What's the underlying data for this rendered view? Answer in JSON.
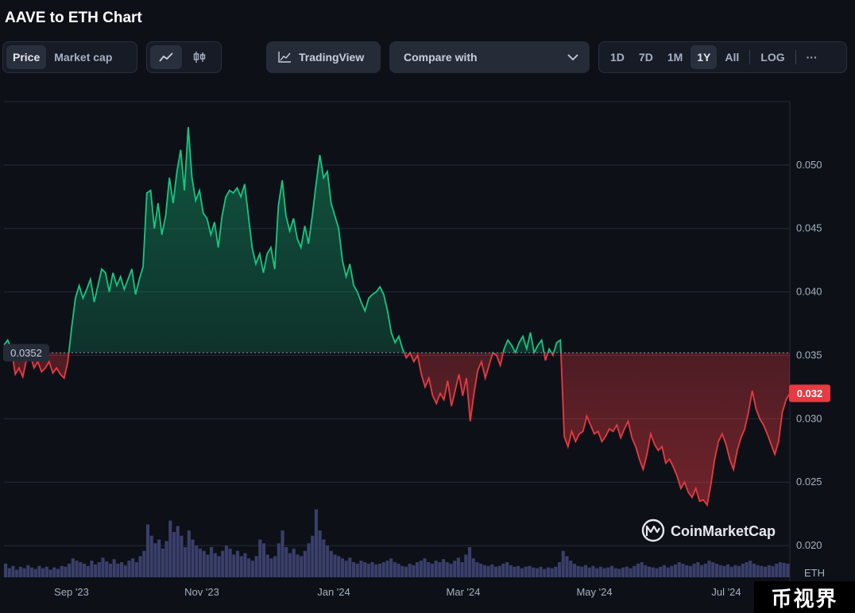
{
  "title": "AAVE to ETH Chart",
  "toolbar": {
    "metric_tabs": [
      "Price",
      "Market cap"
    ],
    "active_metric": "Price",
    "chart_type_icons": [
      "line-chart-icon",
      "candlestick-icon"
    ],
    "tradingview_label": "TradingView",
    "compare_label": "Compare with",
    "ranges": [
      "1D",
      "7D",
      "1M",
      "1Y",
      "All"
    ],
    "active_range": "1Y",
    "log_label": "LOG",
    "more_label": "···"
  },
  "chart_data": {
    "type": "area",
    "baseline_value": 0.0352,
    "baseline_label": "0.0352",
    "current_value": 0.032,
    "current_label": "0.032",
    "y_ticks": [
      "0.050",
      "0.045",
      "0.040",
      "0.035",
      "0.030",
      "0.025",
      "0.020"
    ],
    "ylim": [
      0.0175,
      0.055
    ],
    "x_ticks": [
      "Sep '23",
      "Nov '23",
      "Jan '24",
      "Mar '24",
      "May '24",
      "Jul '24"
    ],
    "unit_label": "ETH",
    "brand_label": "CoinMarketCap",
    "colors": {
      "up": "#16c784",
      "down": "#ea3943",
      "volume": "#3a3f6b",
      "grid": "#252a36"
    },
    "grid": true,
    "price_series": [
      0.0358,
      0.0362,
      0.0355,
      0.0335,
      0.034,
      0.0333,
      0.0347,
      0.035,
      0.034,
      0.0345,
      0.0337,
      0.034,
      0.0345,
      0.0336,
      0.034,
      0.0335,
      0.0332,
      0.0345,
      0.0372,
      0.0395,
      0.0405,
      0.0395,
      0.0402,
      0.041,
      0.0392,
      0.0405,
      0.0418,
      0.0415,
      0.04,
      0.0415,
      0.0405,
      0.0412,
      0.0402,
      0.041,
      0.0418,
      0.0398,
      0.041,
      0.042,
      0.0478,
      0.048,
      0.045,
      0.047,
      0.0445,
      0.046,
      0.049,
      0.047,
      0.0495,
      0.0512,
      0.048,
      0.053,
      0.049,
      0.0472,
      0.048,
      0.0462,
      0.0458,
      0.0445,
      0.0455,
      0.0435,
      0.046,
      0.0475,
      0.048,
      0.0478,
      0.0482,
      0.0475,
      0.0485,
      0.046,
      0.0435,
      0.0422,
      0.043,
      0.0415,
      0.043,
      0.0435,
      0.0418,
      0.0468,
      0.0488,
      0.046,
      0.0448,
      0.0458,
      0.0442,
      0.0435,
      0.0452,
      0.0438,
      0.046,
      0.0485,
      0.0508,
      0.049,
      0.0495,
      0.047,
      0.046,
      0.045,
      0.0425,
      0.0412,
      0.0422,
      0.0405,
      0.04,
      0.0392,
      0.0385,
      0.0395,
      0.0398,
      0.04,
      0.0404,
      0.0398,
      0.0385,
      0.0368,
      0.036,
      0.0365,
      0.0355,
      0.0348,
      0.0352,
      0.0345,
      0.035,
      0.0335,
      0.0325,
      0.0332,
      0.0318,
      0.0312,
      0.032,
      0.0315,
      0.033,
      0.031,
      0.0322,
      0.0335,
      0.0318,
      0.0332,
      0.0298,
      0.032,
      0.0338,
      0.0345,
      0.0332,
      0.0342,
      0.0352,
      0.035,
      0.0342,
      0.0355,
      0.0362,
      0.0358,
      0.0352,
      0.036,
      0.0365,
      0.0355,
      0.0368,
      0.0352,
      0.0358,
      0.0362,
      0.0346,
      0.0355,
      0.035,
      0.036,
      0.0362,
      0.0286,
      0.0278,
      0.029,
      0.0282,
      0.0288,
      0.029,
      0.0302,
      0.0295,
      0.0288,
      0.029,
      0.0282,
      0.0286,
      0.0292,
      0.029,
      0.0295,
      0.0285,
      0.0292,
      0.0298,
      0.0285,
      0.0278,
      0.0268,
      0.026,
      0.0272,
      0.0288,
      0.028,
      0.0275,
      0.0278,
      0.0265,
      0.0268,
      0.0262,
      0.0255,
      0.0245,
      0.025,
      0.0242,
      0.0238,
      0.0245,
      0.0235,
      0.0236,
      0.0232,
      0.0248,
      0.0268,
      0.0282,
      0.0288,
      0.028,
      0.0268,
      0.026,
      0.0275,
      0.0285,
      0.0292,
      0.0305,
      0.0322,
      0.0308,
      0.03,
      0.0295,
      0.0288,
      0.028,
      0.0272,
      0.0282,
      0.0305,
      0.0315,
      0.032
    ],
    "volume_series": [
      0.18,
      0.12,
      0.15,
      0.1,
      0.14,
      0.12,
      0.16,
      0.13,
      0.11,
      0.15,
      0.12,
      0.14,
      0.1,
      0.13,
      0.11,
      0.15,
      0.14,
      0.18,
      0.25,
      0.22,
      0.2,
      0.18,
      0.15,
      0.22,
      0.17,
      0.2,
      0.26,
      0.21,
      0.18,
      0.24,
      0.18,
      0.2,
      0.16,
      0.22,
      0.25,
      0.2,
      0.28,
      0.35,
      0.7,
      0.55,
      0.45,
      0.5,
      0.38,
      0.48,
      0.75,
      0.6,
      0.68,
      0.55,
      0.4,
      0.62,
      0.5,
      0.42,
      0.38,
      0.35,
      0.3,
      0.4,
      0.32,
      0.28,
      0.35,
      0.42,
      0.38,
      0.3,
      0.35,
      0.28,
      0.32,
      0.25,
      0.22,
      0.28,
      0.5,
      0.45,
      0.3,
      0.25,
      0.28,
      0.45,
      0.62,
      0.4,
      0.32,
      0.38,
      0.3,
      0.28,
      0.35,
      0.45,
      0.55,
      0.9,
      0.62,
      0.5,
      0.42,
      0.35,
      0.3,
      0.28,
      0.25,
      0.22,
      0.26,
      0.2,
      0.18,
      0.22,
      0.2,
      0.18,
      0.2,
      0.17,
      0.18,
      0.2,
      0.22,
      0.25,
      0.2,
      0.18,
      0.15,
      0.14,
      0.18,
      0.16,
      0.2,
      0.22,
      0.25,
      0.2,
      0.18,
      0.22,
      0.2,
      0.24,
      0.2,
      0.18,
      0.22,
      0.26,
      0.2,
      0.3,
      0.4,
      0.25,
      0.2,
      0.18,
      0.16,
      0.15,
      0.17,
      0.14,
      0.15,
      0.18,
      0.2,
      0.16,
      0.14,
      0.15,
      0.12,
      0.14,
      0.15,
      0.13,
      0.12,
      0.14,
      0.11,
      0.13,
      0.12,
      0.14,
      0.2,
      0.35,
      0.28,
      0.22,
      0.18,
      0.15,
      0.14,
      0.16,
      0.13,
      0.15,
      0.12,
      0.14,
      0.12,
      0.13,
      0.15,
      0.12,
      0.11,
      0.13,
      0.14,
      0.12,
      0.15,
      0.18,
      0.2,
      0.16,
      0.14,
      0.13,
      0.12,
      0.14,
      0.16,
      0.13,
      0.15,
      0.17,
      0.2,
      0.18,
      0.16,
      0.15,
      0.18,
      0.2,
      0.16,
      0.18,
      0.22,
      0.2,
      0.18,
      0.16,
      0.15,
      0.17,
      0.14,
      0.16,
      0.15,
      0.18,
      0.2,
      0.22,
      0.18,
      0.16,
      0.15,
      0.14,
      0.16,
      0.15,
      0.18,
      0.2,
      0.19,
      0.18
    ]
  },
  "watermark": "币视界"
}
